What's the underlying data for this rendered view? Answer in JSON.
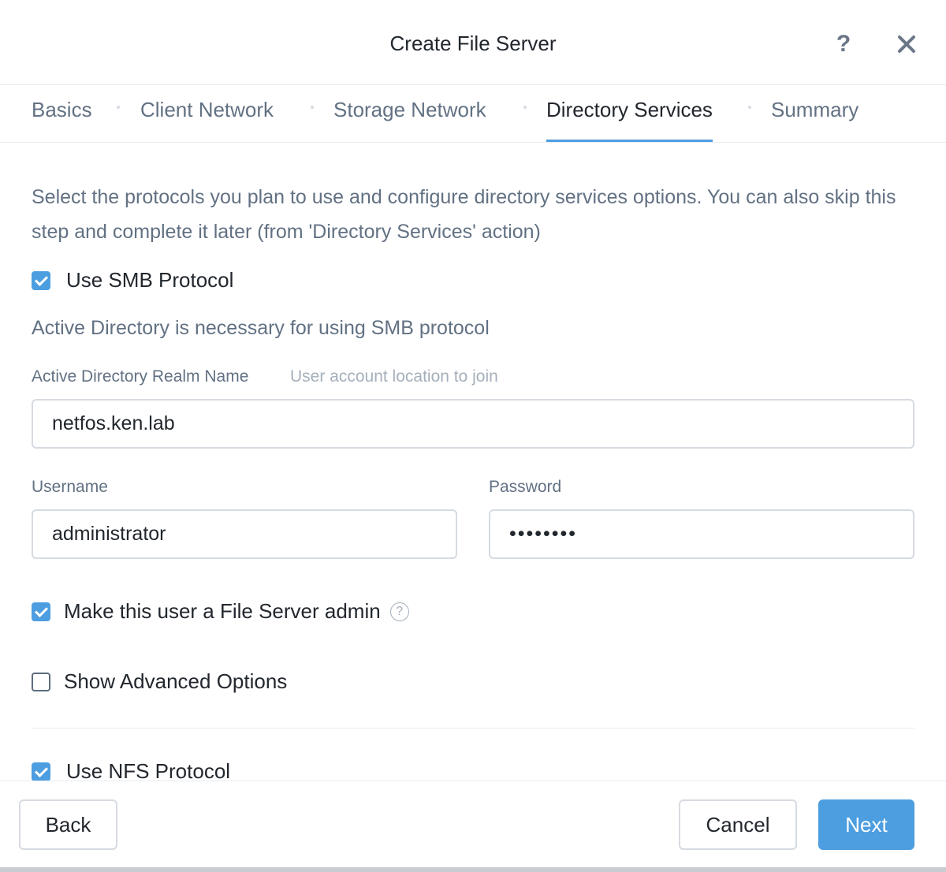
{
  "dialog": {
    "title": "Create File Server",
    "help_icon": "help-icon",
    "close_icon": "close-icon"
  },
  "tabs": [
    {
      "label": "Basics",
      "active": false
    },
    {
      "label": "Client Network",
      "active": false
    },
    {
      "label": "Storage Network",
      "active": false
    },
    {
      "label": "Directory Services",
      "active": true
    },
    {
      "label": "Summary",
      "active": false
    }
  ],
  "content": {
    "intro": "Select the protocols you plan to use and configure directory services options. You can also skip this step and complete it later (from 'Directory Services' action)",
    "smb": {
      "label": "Use SMB Protocol",
      "checked": true
    },
    "ad_note": "Active Directory is necessary for using SMB protocol",
    "realm": {
      "label": "Active Directory Realm Name",
      "hint": "User account location to join",
      "value": "netfos.ken.lab"
    },
    "username": {
      "label": "Username",
      "value": "administrator"
    },
    "password": {
      "label": "Password",
      "value": "••••••••"
    },
    "fs_admin": {
      "label": "Make this user a File Server admin",
      "checked": true,
      "help_glyph": "?"
    },
    "advanced": {
      "label": "Show Advanced Options",
      "checked": false
    },
    "nfs": {
      "label": "Use NFS Protocol",
      "checked": true
    }
  },
  "footer": {
    "back_label": "Back",
    "cancel_label": "Cancel",
    "next_label": "Next"
  },
  "colors": {
    "accent": "#4d9ee0",
    "text_primary": "#22272e",
    "text_secondary": "#627183"
  }
}
